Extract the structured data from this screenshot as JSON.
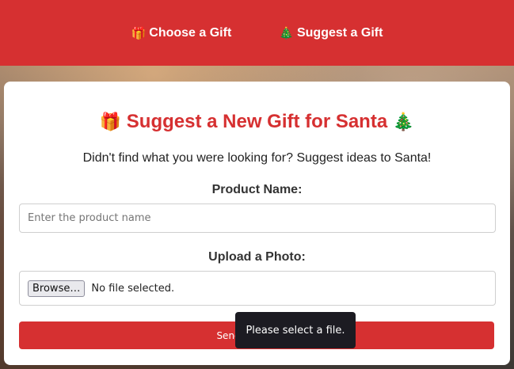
{
  "nav": {
    "choose": {
      "icon": "🎁",
      "label": "Choose a Gift"
    },
    "suggest": {
      "icon": "🎄",
      "label": "Suggest a Gift"
    }
  },
  "form": {
    "title_icon_left": "🎁",
    "title": "Suggest a New Gift for Santa",
    "title_icon_right": "🎄",
    "subtitle": "Didn't find what you were looking for? Suggest ideas to Santa!",
    "product_label": "Product Name:",
    "product_placeholder": "Enter the product name",
    "product_value": "",
    "photo_label": "Upload a Photo:",
    "browse_label": "Browse…",
    "file_status": "No file selected.",
    "submit_label": "Send Suggestion"
  },
  "tooltip": {
    "text": "Please select a file."
  },
  "colors": {
    "accent": "#d63031",
    "tooltip_bg": "#1c1b22"
  }
}
